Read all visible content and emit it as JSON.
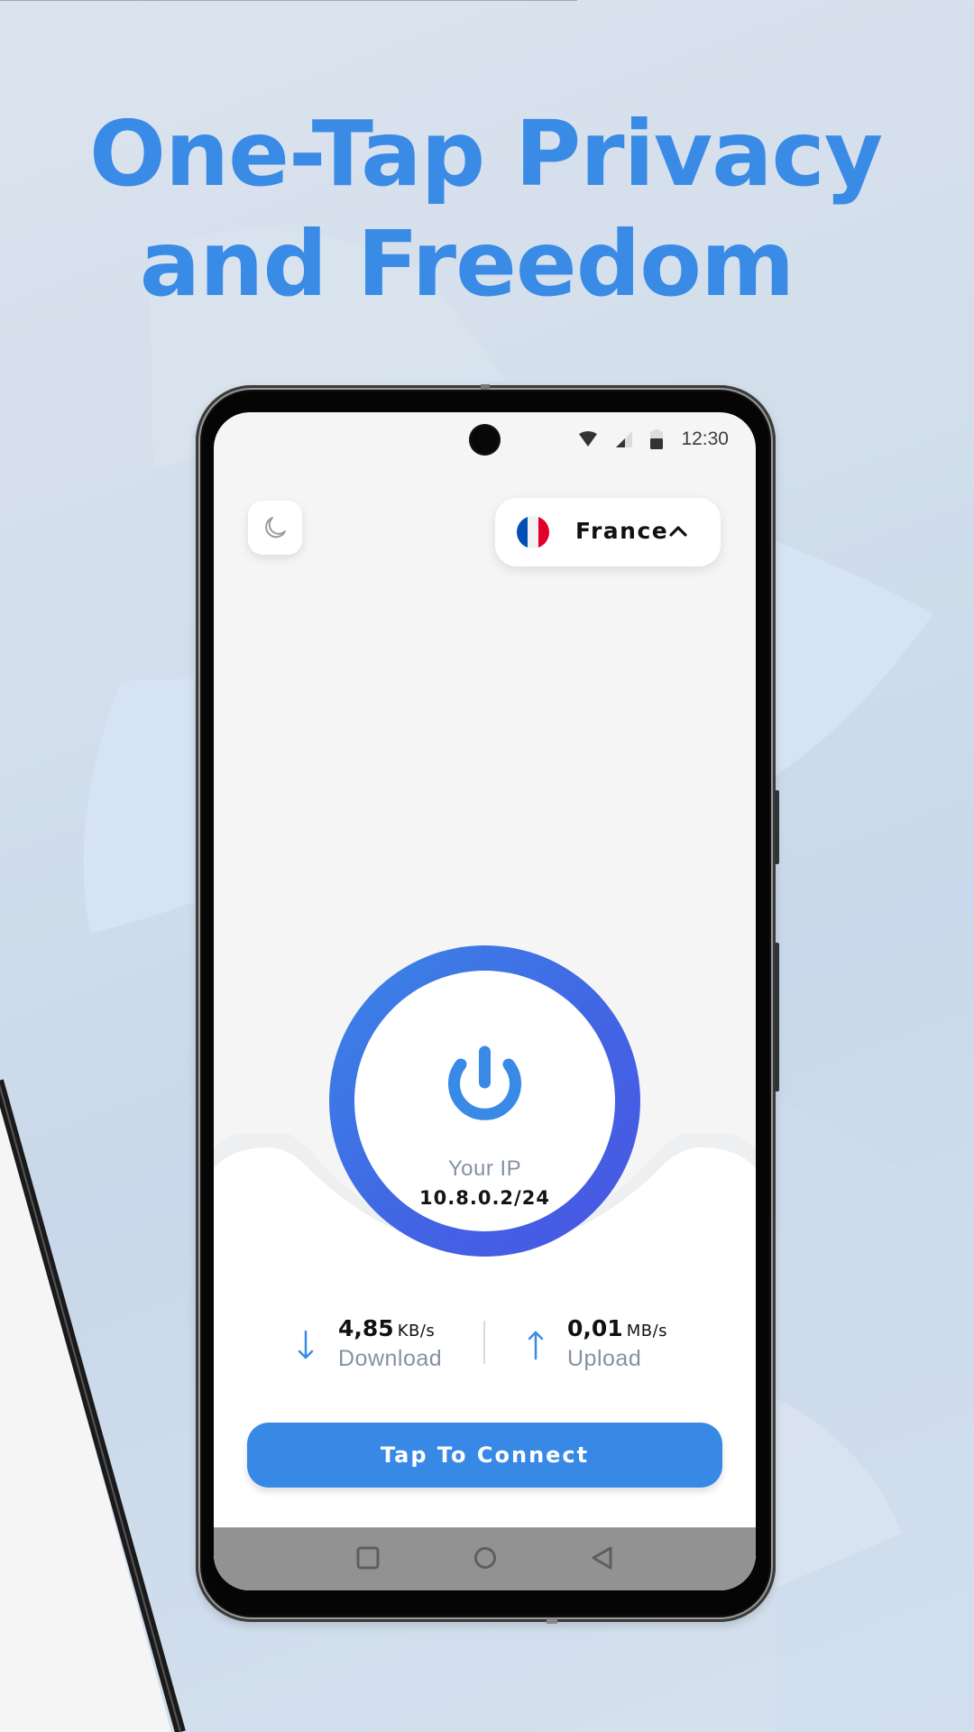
{
  "headline": {
    "line1": "One-Tap Privacy",
    "line2": "and Freedom",
    "color": "#3a8be6"
  },
  "status_bar": {
    "time": "12:30",
    "icons": [
      "wifi-icon",
      "signal-icon",
      "battery-icon"
    ]
  },
  "top_controls": {
    "theme_toggle_icon": "moon-icon",
    "country": {
      "name": "France",
      "flag": [
        "#0050b4",
        "#f1f1f1",
        "#e2002b"
      ],
      "chevron": "chevron-up-icon"
    }
  },
  "power": {
    "icon": "power-icon",
    "ip_label": "Your IP",
    "ip_value": "10.8.0.2/24",
    "ring_colors": [
      "#3a86e6",
      "#4a55e2"
    ]
  },
  "stats": {
    "download": {
      "value": "4,85",
      "unit": "KB/s",
      "label": "Download",
      "icon": "arrow-down-icon"
    },
    "upload": {
      "value": "0,01",
      "unit": "MB/s",
      "label": "Upload",
      "icon": "arrow-up-icon"
    }
  },
  "connect_button": {
    "label": "Tap To Connect",
    "color": "#3889e6"
  },
  "nav_bar": {
    "buttons": [
      "recents-icon",
      "home-icon",
      "back-icon"
    ]
  }
}
